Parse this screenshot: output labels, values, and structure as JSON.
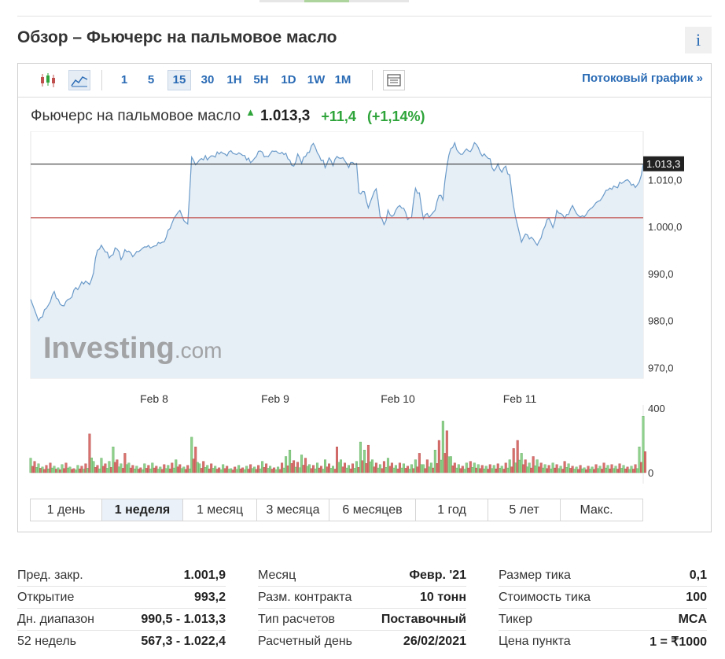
{
  "page": {
    "title": "Обзор – Фьючерс на пальмовое масло"
  },
  "toolbar": {
    "timeframes": [
      "1",
      "5",
      "15",
      "30",
      "1H",
      "5H",
      "1D",
      "1W",
      "1M"
    ],
    "active_timeframe": "15",
    "stream_link": "Потоковый график »"
  },
  "quote": {
    "name": "Фьючерс на пальмовое масло",
    "price": "1.013,3",
    "change": "+11,4",
    "change_pct": "(+1,14%)"
  },
  "colors": {
    "up": "#2ea43a",
    "down": "#c0504d",
    "line": "#6b9bc9",
    "fill": "#e6eef6",
    "link": "#2a6bb5"
  },
  "chart_data": {
    "type": "line",
    "x_ticks": [
      "Feb 8",
      "Feb 9",
      "Feb 10",
      "Feb 11"
    ],
    "y_ticks": [
      "1.010,0",
      "1.000,0",
      "990,0",
      "980,0",
      "970,0"
    ],
    "y_range": [
      967.7,
      1020.3
    ],
    "current_price_label": "1.013,3",
    "current_price": 1013.3,
    "previous_close": 1001.9,
    "volume_ticks": [
      "400",
      "0"
    ],
    "volume_range": [
      0,
      400
    ],
    "price_keypoints": [
      [
        0,
        984.5
      ],
      [
        10,
        980
      ],
      [
        20,
        982.5
      ],
      [
        30,
        986
      ],
      [
        40,
        983
      ],
      [
        50,
        985
      ],
      [
        60,
        987
      ],
      [
        70,
        988.5
      ],
      [
        75,
        987.5
      ],
      [
        80,
        990.5
      ],
      [
        85,
        995
      ],
      [
        90,
        996
      ],
      [
        95,
        995
      ],
      [
        100,
        993.5
      ],
      [
        110,
        995.5
      ],
      [
        115,
        993
      ],
      [
        120,
        995
      ],
      [
        130,
        994
      ],
      [
        140,
        995.5
      ],
      [
        150,
        995.5
      ],
      [
        160,
        996
      ],
      [
        170,
        997
      ],
      [
        175,
        999
      ],
      [
        180,
        1001
      ],
      [
        185,
        1002
      ],
      [
        190,
        1003
      ],
      [
        195,
        1001
      ],
      [
        200,
        1000.5
      ],
      [
        205,
        1015
      ],
      [
        210,
        1013.5
      ],
      [
        220,
        1014.5
      ],
      [
        230,
        1015
      ],
      [
        240,
        1015.5
      ],
      [
        250,
        1015.5
      ],
      [
        260,
        1016
      ],
      [
        270,
        1015
      ],
      [
        280,
        1014
      ],
      [
        290,
        1016
      ],
      [
        300,
        1015
      ],
      [
        310,
        1016.5
      ],
      [
        320,
        1015.5
      ],
      [
        325,
        1016
      ],
      [
        330,
        1014
      ],
      [
        335,
        1013
      ],
      [
        340,
        1015.5
      ],
      [
        345,
        1014
      ],
      [
        350,
        1015
      ],
      [
        355,
        1016
      ],
      [
        360,
        1017.5
      ],
      [
        365,
        1016
      ],
      [
        370,
        1014.5
      ],
      [
        375,
        1013
      ],
      [
        380,
        1015
      ],
      [
        385,
        1013.5
      ],
      [
        390,
        1015
      ],
      [
        400,
        1014
      ],
      [
        405,
        1013
      ],
      [
        410,
        1013.5
      ],
      [
        415,
        1013
      ],
      [
        418,
        1007
      ],
      [
        425,
        1007
      ],
      [
        430,
        1004
      ],
      [
        440,
        1008
      ],
      [
        445,
        1002
      ],
      [
        450,
        1000.5
      ],
      [
        455,
        1003
      ],
      [
        460,
        1002
      ],
      [
        470,
        1004.5
      ],
      [
        475,
        1003.5
      ],
      [
        480,
        1002
      ],
      [
        485,
        1002
      ],
      [
        490,
        1008
      ],
      [
        495,
        1007
      ],
      [
        500,
        1002
      ],
      [
        505,
        1003
      ],
      [
        510,
        1002
      ],
      [
        515,
        1004
      ],
      [
        520,
        1007
      ],
      [
        525,
        1006
      ],
      [
        530,
        1013
      ],
      [
        535,
        1016.5
      ],
      [
        540,
        1017.5
      ],
      [
        545,
        1016
      ],
      [
        550,
        1015
      ],
      [
        555,
        1017
      ],
      [
        560,
        1016
      ],
      [
        565,
        1018
      ],
      [
        570,
        1017
      ],
      [
        575,
        1015.5
      ],
      [
        580,
        1015
      ],
      [
        585,
        1014
      ],
      [
        590,
        1012
      ],
      [
        595,
        1013.5
      ],
      [
        600,
        1012
      ],
      [
        605,
        1012.5
      ],
      [
        610,
        1011
      ],
      [
        615,
        1004.5
      ],
      [
        620,
        1000
      ],
      [
        625,
        997
      ],
      [
        630,
        998
      ],
      [
        640,
        997
      ],
      [
        645,
        996.5
      ],
      [
        650,
        998
      ],
      [
        660,
        1002
      ],
      [
        665,
        1000
      ],
      [
        670,
        1003
      ],
      [
        680,
        1002
      ],
      [
        690,
        1004
      ],
      [
        700,
        1002
      ],
      [
        710,
        1003
      ],
      [
        720,
        1005
      ],
      [
        730,
        1007
      ],
      [
        740,
        1008
      ],
      [
        750,
        1009
      ],
      [
        760,
        1010.5
      ],
      [
        765,
        1009
      ],
      [
        770,
        1008
      ],
      [
        775,
        1009.5
      ],
      [
        780,
        1013.3
      ]
    ],
    "volumes": [
      [
        0,
        90,
        1
      ],
      [
        5,
        70,
        0
      ],
      [
        10,
        55,
        1
      ],
      [
        15,
        35,
        1
      ],
      [
        20,
        45,
        0
      ],
      [
        25,
        60,
        0
      ],
      [
        30,
        40,
        1
      ],
      [
        35,
        30,
        1
      ],
      [
        40,
        50,
        1
      ],
      [
        45,
        60,
        0
      ],
      [
        50,
        35,
        1
      ],
      [
        55,
        25,
        0
      ],
      [
        60,
        45,
        1
      ],
      [
        65,
        40,
        0
      ],
      [
        70,
        55,
        0
      ],
      [
        75,
        240,
        0
      ],
      [
        80,
        70,
        1
      ],
      [
        85,
        45,
        0
      ],
      [
        90,
        90,
        1
      ],
      [
        95,
        55,
        0
      ],
      [
        100,
        70,
        1
      ],
      [
        105,
        160,
        1
      ],
      [
        110,
        80,
        0
      ],
      [
        115,
        55,
        1
      ],
      [
        120,
        120,
        0
      ],
      [
        125,
        60,
        1
      ],
      [
        130,
        45,
        0
      ],
      [
        135,
        40,
        1
      ],
      [
        140,
        30,
        0
      ],
      [
        145,
        55,
        1
      ],
      [
        150,
        45,
        0
      ],
      [
        155,
        60,
        1
      ],
      [
        160,
        40,
        0
      ],
      [
        165,
        35,
        1
      ],
      [
        170,
        50,
        0
      ],
      [
        175,
        45,
        1
      ],
      [
        180,
        60,
        0
      ],
      [
        185,
        80,
        1
      ],
      [
        190,
        50,
        0
      ],
      [
        195,
        35,
        1
      ],
      [
        200,
        45,
        0
      ],
      [
        205,
        220,
        1
      ],
      [
        210,
        160,
        0
      ],
      [
        215,
        55,
        1
      ],
      [
        220,
        70,
        0
      ],
      [
        225,
        45,
        1
      ],
      [
        230,
        55,
        0
      ],
      [
        235,
        40,
        1
      ],
      [
        240,
        30,
        0
      ],
      [
        245,
        50,
        1
      ],
      [
        250,
        40,
        0
      ],
      [
        255,
        25,
        1
      ],
      [
        260,
        35,
        0
      ],
      [
        265,
        45,
        1
      ],
      [
        270,
        30,
        0
      ],
      [
        275,
        40,
        1
      ],
      [
        280,
        50,
        0
      ],
      [
        285,
        35,
        1
      ],
      [
        290,
        45,
        0
      ],
      [
        295,
        70,
        1
      ],
      [
        300,
        55,
        0
      ],
      [
        305,
        40,
        1
      ],
      [
        310,
        30,
        0
      ],
      [
        315,
        35,
        1
      ],
      [
        320,
        60,
        0
      ],
      [
        325,
        100,
        1
      ],
      [
        330,
        140,
        1
      ],
      [
        335,
        75,
        0
      ],
      [
        340,
        65,
        0
      ],
      [
        345,
        110,
        1
      ],
      [
        350,
        90,
        0
      ],
      [
        355,
        50,
        1
      ],
      [
        360,
        45,
        0
      ],
      [
        365,
        60,
        1
      ],
      [
        370,
        40,
        0
      ],
      [
        375,
        80,
        1
      ],
      [
        380,
        55,
        0
      ],
      [
        385,
        40,
        1
      ],
      [
        390,
        160,
        0
      ],
      [
        395,
        80,
        1
      ],
      [
        400,
        60,
        0
      ],
      [
        405,
        45,
        1
      ],
      [
        410,
        55,
        0
      ],
      [
        415,
        70,
        1
      ],
      [
        420,
        190,
        1
      ],
      [
        425,
        140,
        1
      ],
      [
        430,
        170,
        0
      ],
      [
        435,
        80,
        1
      ],
      [
        440,
        60,
        0
      ],
      [
        445,
        50,
        1
      ],
      [
        450,
        70,
        0
      ],
      [
        455,
        90,
        1
      ],
      [
        460,
        60,
        0
      ],
      [
        465,
        45,
        1
      ],
      [
        470,
        60,
        0
      ],
      [
        475,
        55,
        1
      ],
      [
        480,
        40,
        0
      ],
      [
        485,
        50,
        1
      ],
      [
        490,
        80,
        1
      ],
      [
        495,
        120,
        0
      ],
      [
        500,
        50,
        1
      ],
      [
        505,
        80,
        0
      ],
      [
        510,
        60,
        1
      ],
      [
        515,
        140,
        1
      ],
      [
        520,
        200,
        0
      ],
      [
        525,
        320,
        1
      ],
      [
        530,
        260,
        0
      ],
      [
        535,
        100,
        1
      ],
      [
        540,
        60,
        0
      ],
      [
        545,
        50,
        1
      ],
      [
        550,
        40,
        0
      ],
      [
        555,
        60,
        1
      ],
      [
        560,
        70,
        0
      ],
      [
        565,
        60,
        1
      ],
      [
        570,
        50,
        1
      ],
      [
        575,
        45,
        0
      ],
      [
        580,
        40,
        1
      ],
      [
        585,
        50,
        0
      ],
      [
        590,
        45,
        1
      ],
      [
        595,
        55,
        0
      ],
      [
        600,
        40,
        1
      ],
      [
        605,
        60,
        0
      ],
      [
        610,
        80,
        1
      ],
      [
        615,
        150,
        0
      ],
      [
        620,
        200,
        0
      ],
      [
        625,
        120,
        1
      ],
      [
        630,
        80,
        0
      ],
      [
        635,
        60,
        1
      ],
      [
        640,
        100,
        0
      ],
      [
        645,
        80,
        1
      ],
      [
        650,
        60,
        0
      ],
      [
        655,
        50,
        1
      ],
      [
        660,
        45,
        0
      ],
      [
        665,
        60,
        1
      ],
      [
        670,
        50,
        0
      ],
      [
        675,
        40,
        1
      ],
      [
        680,
        70,
        0
      ],
      [
        685,
        55,
        1
      ],
      [
        690,
        40,
        0
      ],
      [
        695,
        35,
        1
      ],
      [
        700,
        45,
        0
      ],
      [
        705,
        30,
        1
      ],
      [
        710,
        40,
        0
      ],
      [
        715,
        35,
        1
      ],
      [
        720,
        50,
        0
      ],
      [
        725,
        40,
        1
      ],
      [
        730,
        60,
        0
      ],
      [
        735,
        45,
        1
      ],
      [
        740,
        50,
        0
      ],
      [
        745,
        40,
        1
      ],
      [
        750,
        55,
        0
      ],
      [
        755,
        45,
        1
      ],
      [
        760,
        35,
        0
      ],
      [
        765,
        40,
        1
      ],
      [
        770,
        50,
        0
      ],
      [
        775,
        160,
        1
      ],
      [
        780,
        350,
        1
      ]
    ]
  },
  "watermark": {
    "brand": "Investing",
    "suffix": ".com"
  },
  "ranges": [
    "1 день",
    "1 неделя",
    "1 месяц",
    "3 месяца",
    "6 месяцев",
    "1 год",
    "5 лет",
    "Макс."
  ],
  "active_range": "1 неделя",
  "stats": {
    "col1": [
      {
        "label": "Пред. закр.",
        "value": "1.001,9"
      },
      {
        "label": "Открытие",
        "value": "993,2"
      },
      {
        "label": "Дн. диапазон",
        "value": "990,5 - 1.013,3"
      },
      {
        "label": "52 недель",
        "value": "567,3 - 1.022,4"
      }
    ],
    "col2": [
      {
        "label": "Месяц",
        "value": "Февр. '21"
      },
      {
        "label": "Разм. контракта",
        "value": "10 тонн"
      },
      {
        "label": "Тип расчетов",
        "value": "Поставочный"
      },
      {
        "label": "Расчетный день",
        "value": "26/02/2021"
      }
    ],
    "col3": [
      {
        "label": "Размер тика",
        "value": "0,1"
      },
      {
        "label": "Стоимость тика",
        "value": "100"
      },
      {
        "label": "Тикер",
        "value": "MCA"
      },
      {
        "label": "Цена пункта",
        "value": "1 = ₹1000"
      }
    ]
  }
}
